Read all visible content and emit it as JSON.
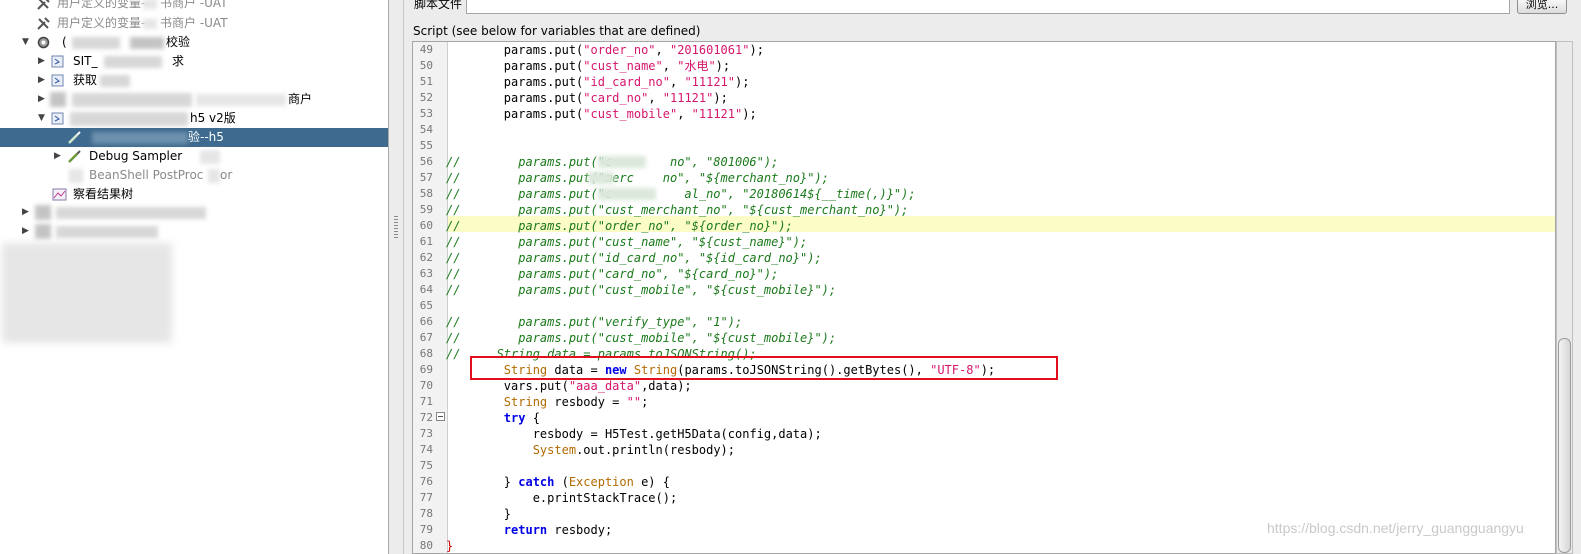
{
  "tree": {
    "items": [
      {
        "label": "用户定义的变量-",
        "label2": "书商户 -UAT"
      },
      {
        "label": "用户定义的变量-",
        "label2": "书商户 -UAT"
      },
      {
        "label": "(",
        "label2": "校验"
      },
      {
        "label": "SIT_",
        "label2": "求"
      },
      {
        "label": "获取",
        "label2": ""
      },
      {
        "label": "",
        "label2": "商户"
      },
      {
        "label": "",
        "label2": "h5 v2版"
      },
      {
        "label": "",
        "label2": "验--h5"
      },
      {
        "label": "Debug Sampler",
        "label2": ""
      },
      {
        "label": "BeanShell PostProc",
        "label2": "or"
      },
      {
        "label": "察看结果树",
        "label2": ""
      }
    ]
  },
  "editor": {
    "top_field_label": "脚本文件",
    "top_button_label": "浏览...",
    "script_label": "Script (see below for variables that are defined)",
    "line_numbers": [
      "49",
      "50",
      "51",
      "52",
      "53",
      "54",
      "55",
      "56",
      "57",
      "58",
      "59",
      "60",
      "61",
      "62",
      "63",
      "64",
      "65",
      "66",
      "67",
      "68",
      "69",
      "70",
      "71",
      "72",
      "73",
      "74",
      "75",
      "76",
      "77",
      "78",
      "79",
      "80"
    ],
    "highlighted_line": "60",
    "lines": {
      "l49": {
        "a": "params.put(",
        "s1": "\"order_no\"",
        "b": ", ",
        "s2": "\"201601061\"",
        "c": ");"
      },
      "l50": {
        "a": "params.put(",
        "s1": "\"cust_name\"",
        "b": ", ",
        "s2": "\"水电\"",
        "c": ");"
      },
      "l51": {
        "a": "params.put(",
        "s1": "\"id_card_no\"",
        "b": ", ",
        "s2": "\"11121\"",
        "c": ");"
      },
      "l52": {
        "a": "params.put(",
        "s1": "\"card_no\"",
        "b": ", ",
        "s2": "\"11121\"",
        "c": ");"
      },
      "l53": {
        "a": "params.put(",
        "s1": "\"cust_mobile\"",
        "b": ", ",
        "s2": "\"11121\"",
        "c": ");"
      },
      "l56": "//        params.put(\"c        no\", \"801006\");",
      "l57": "//        params.put(\"merc    no\", \"${merchant_no}\");",
      "l58": "//        params.put(\"c          al_no\", \"20180614${__time(,)}\");",
      "l59": "//        params.put(\"cust_merchant_no\", \"${cust_merchant_no}\");",
      "l60": "//        params.put(\"order_no\", \"${order_no}\");",
      "l61": "//        params.put(\"cust_name\", \"${cust_name}\");",
      "l62": "//        params.put(\"id_card_no\", \"${id_card_no}\");",
      "l63": "//        params.put(\"card_no\", \"${card_no}\");",
      "l64": "//        params.put(\"cust_mobile\", \"${cust_mobile}\");",
      "l66": "//        params.put(\"verify_type\", \"1\");",
      "l67": "//        params.put(\"cust_mobile\", \"${cust_mobile}\");",
      "l68": "//     String data = params.toJSONString();",
      "l69": {
        "t1": "String",
        "a": " data = ",
        "k1": "new",
        "b": " ",
        "t2": "String",
        "c": "(params.toJSONString().getBytes(), ",
        "s1": "\"UTF-8\"",
        "d": ");"
      },
      "l70": {
        "a": "vars.put(",
        "s1": "\"aaa_data\"",
        "b": ",data);"
      },
      "l71": {
        "t1": "String",
        "a": " resbody = ",
        "s1": "\"\"",
        "b": ";"
      },
      "l72": {
        "k1": "try",
        "a": " {"
      },
      "l73": "resbody = H5Test.getH5Data(config,data);",
      "l74": {
        "t1": "System",
        "a": ".out.println(resbody);"
      },
      "l76": {
        "a": "} ",
        "k1": "catch",
        "b": " (",
        "t1": "Exception",
        "c": " e) {"
      },
      "l77": "e.printStackTrace();",
      "l78": "}",
      "l79": {
        "k1": "return",
        "a": " resbody;"
      },
      "l80": "}"
    }
  },
  "watermark": "https://blog.csdn.net/jerry_guangguangyu",
  "colors": {
    "selection": "#3d6a8e",
    "keyword": "#0000e6",
    "string": "#d6166c",
    "comment": "#1b7a1b",
    "type": "#b36a00",
    "highlight": "#fcfcc6",
    "redbox": "#e2101c"
  }
}
